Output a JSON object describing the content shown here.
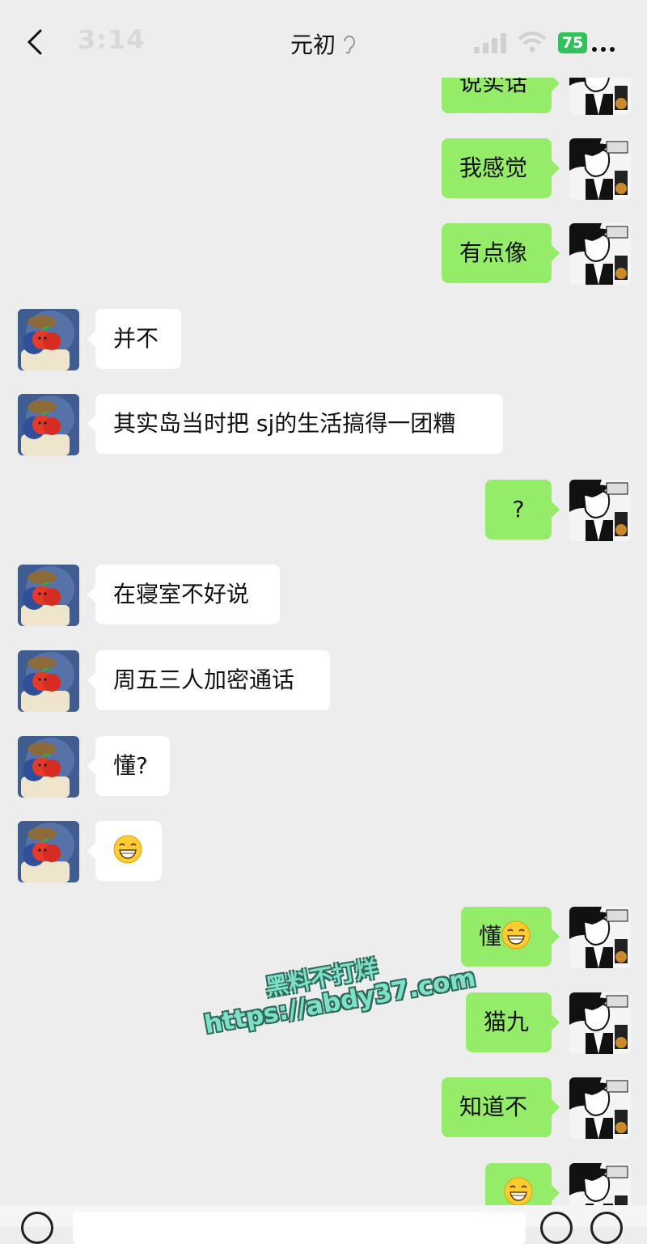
{
  "status_bar": {
    "time": "3:14",
    "battery": "75"
  },
  "chat": {
    "title": "元初"
  },
  "messages": [
    {
      "side": "out",
      "text": "说实话"
    },
    {
      "side": "out",
      "text": "我感觉"
    },
    {
      "side": "out",
      "text": "有点像"
    },
    {
      "side": "in",
      "text": "并不"
    },
    {
      "side": "in",
      "text": "其实岛当时把 sj的生活搞得一团糟"
    },
    {
      "side": "out",
      "text": "?"
    },
    {
      "side": "in",
      "text": "在寝室不好说"
    },
    {
      "side": "in",
      "text": "周五三人加密通话"
    },
    {
      "side": "in",
      "text": "懂?"
    },
    {
      "side": "in",
      "text": "",
      "emoji": "grinning-squint-emoji"
    },
    {
      "side": "out",
      "text": "懂",
      "emoji": "grinning-squint-emoji"
    },
    {
      "side": "out",
      "text": "猫九"
    },
    {
      "side": "out",
      "text": "知道不"
    },
    {
      "side": "out",
      "text": "",
      "emoji": "grinning-squint-emoji"
    }
  ],
  "watermark": {
    "line1": "黑料不打烊",
    "line2": "https://abdy37.com"
  },
  "colors": {
    "background": "#ededed",
    "outgoing_bubble": "#95ec69",
    "incoming_bubble": "#ffffff",
    "battery": "#30c25a"
  }
}
